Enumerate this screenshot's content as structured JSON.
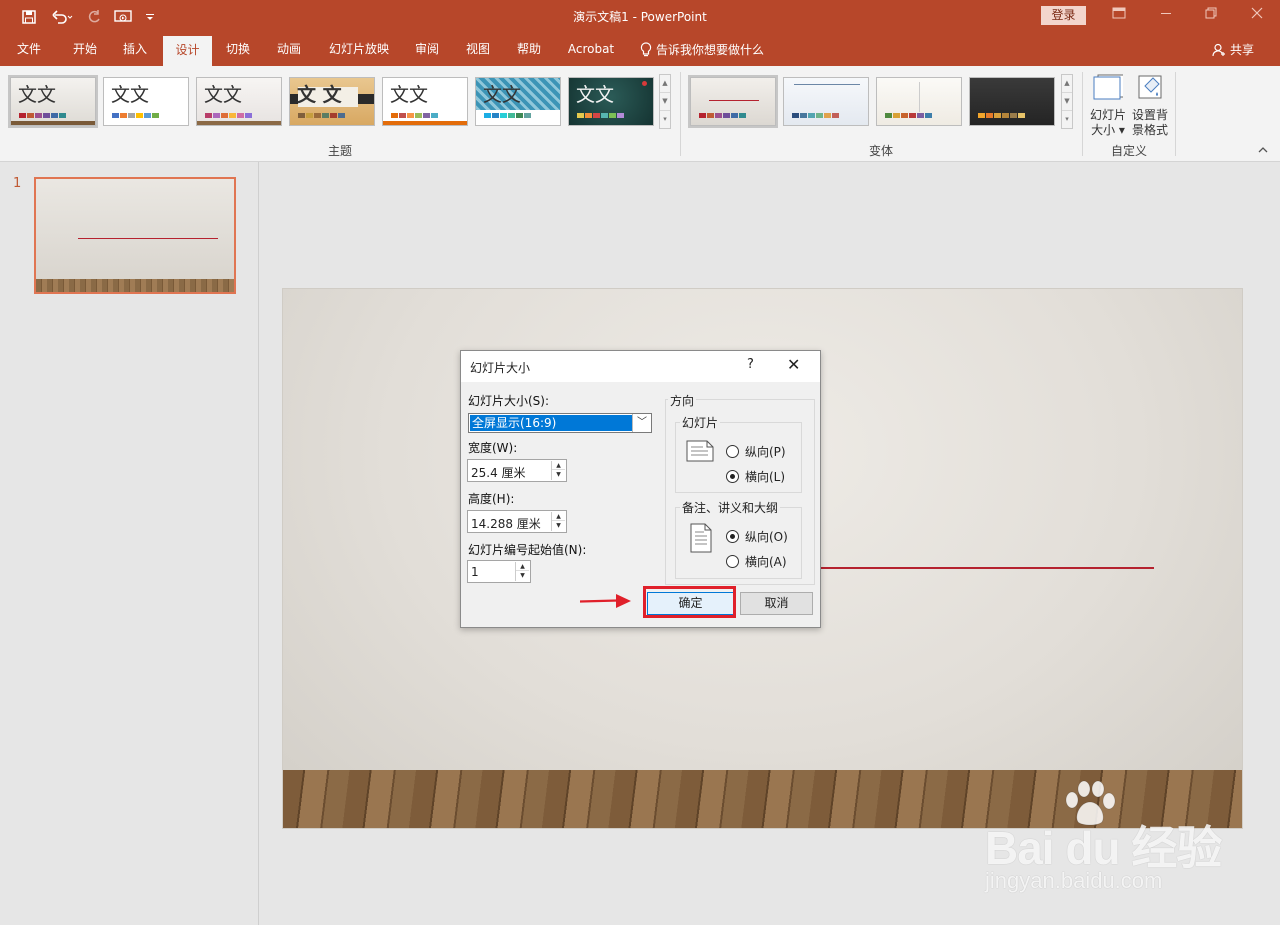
{
  "window": {
    "title": "演示文稿1  -  PowerPoint",
    "login_label": "登录"
  },
  "quick_access": {
    "save_icon": "save-icon",
    "undo_icon": "undo-icon",
    "redo_icon": "redo-icon",
    "present_icon": "start-from-beginning-icon",
    "customize_icon": "customize-toolbar-icon"
  },
  "ribbon_tabs": [
    {
      "label": "文件"
    },
    {
      "label": "开始"
    },
    {
      "label": "插入"
    },
    {
      "label": "设计"
    },
    {
      "label": "切换"
    },
    {
      "label": "动画"
    },
    {
      "label": "幻灯片放映"
    },
    {
      "label": "审阅"
    },
    {
      "label": "视图"
    },
    {
      "label": "帮助"
    },
    {
      "label": "Acrobat"
    }
  ],
  "active_tab": "设计",
  "tell_me": "告诉我你想要做什么",
  "share": "共享",
  "themes": {
    "group_label": "主题",
    "sample_text": [
      "文文",
      "文文",
      "文文",
      "文 文",
      "文文",
      "文文",
      "文文"
    ]
  },
  "variants": {
    "group_label": "变体"
  },
  "customize": {
    "group_label": "自定义",
    "slide_size_line1": "幻灯片",
    "slide_size_line2": "大小 ▾",
    "format_bg_line1": "设置背",
    "format_bg_line2": "景格式"
  },
  "thumbnails": {
    "slide_number": "1"
  },
  "dialog": {
    "title": "幻灯片大小",
    "help": "?",
    "close": "✕",
    "slide_size_label": "幻灯片大小(S):",
    "slide_size_value": "全屏显示(16:9)",
    "width_label": "宽度(W):",
    "width_value": "25.4 厘米",
    "height_label": "高度(H):",
    "height_value": "14.288 厘米",
    "numbering_label": "幻灯片编号起始值(N):",
    "numbering_value": "1",
    "orientation_label": "方向",
    "slides_group": "幻灯片",
    "slides_portrait": "纵向(P)",
    "slides_landscape": "横向(L)",
    "notes_group": "备注、讲义和大纲",
    "notes_portrait": "纵向(O)",
    "notes_landscape": "横向(A)",
    "ok": "确定",
    "cancel": "取消"
  },
  "colors": {
    "accent": "#b7472a",
    "highlight": "#e0202a",
    "selection": "#0078d7"
  },
  "watermark": {
    "logo": "Bai du 经验",
    "url": "jingyan.baidu.com"
  }
}
